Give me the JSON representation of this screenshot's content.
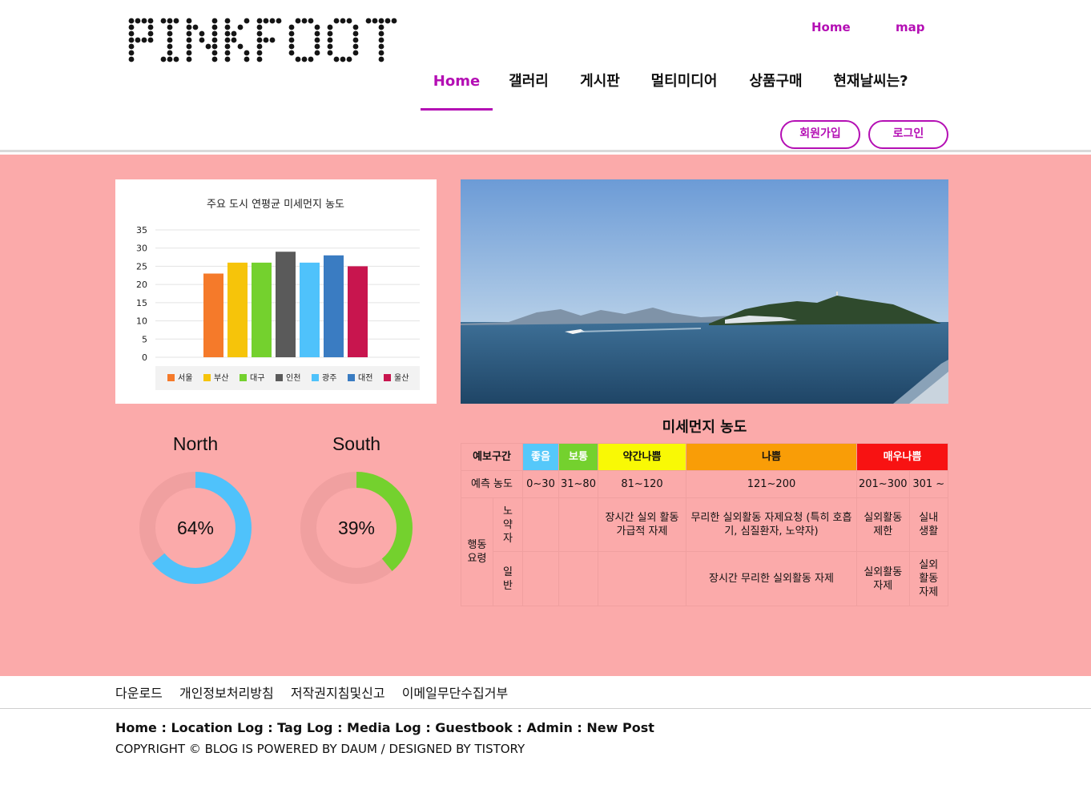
{
  "brand": {
    "logo_text": "PINKFOOT"
  },
  "topnav": {
    "home": "Home",
    "map": "map"
  },
  "mainnav": [
    {
      "label": "Home",
      "active": true
    },
    {
      "label": "갤러리"
    },
    {
      "label": "게시판"
    },
    {
      "label": "멀티미디어"
    },
    {
      "label": "상품구매"
    },
    {
      "label": "현재날씨는?"
    }
  ],
  "auth": {
    "signup": "회원가입",
    "login": "로그인"
  },
  "colors": {
    "accent": "#b40fb4",
    "main_bg": "#fbaaaa"
  },
  "chart_data": {
    "type": "bar",
    "title": "주요 도시 연평균 미세먼지 농도",
    "categories": [
      "서울",
      "부산",
      "대구",
      "인천",
      "광주",
      "대전",
      "울산"
    ],
    "values": [
      23,
      26,
      26,
      29,
      26,
      28,
      25
    ],
    "colors": [
      "#f57a2a",
      "#f6c40a",
      "#74d12e",
      "#5a5a5a",
      "#4fc2fb",
      "#3a7cc2",
      "#c8154e"
    ],
    "ylim": [
      0,
      35
    ],
    "yticks": [
      "35",
      "30",
      "25",
      "20",
      "15",
      "10",
      "5",
      "0"
    ],
    "grid": true,
    "legend": "bottom"
  },
  "donuts": [
    {
      "label": "North",
      "percent_text": "64%",
      "value": 0.64,
      "color": "#4fc2fb"
    },
    {
      "label": "South",
      "percent_text": "39%",
      "value": 0.39,
      "color": "#74d12e"
    }
  ],
  "dust_table": {
    "title": "미세먼지 농도",
    "header_label": "예보구간",
    "grades": [
      {
        "label": "좋음",
        "color": "#55c8fa",
        "text_color": "#ffffff"
      },
      {
        "label": "보통",
        "color": "#74d12e",
        "text_color": "#ffffff"
      },
      {
        "label": "약간나쁨",
        "color": "#f9f905",
        "text_color": "#111111"
      },
      {
        "label": "나쁨",
        "color": "#f99d07",
        "text_color": "#111111"
      },
      {
        "label": "매우나쁨",
        "color": "#f81212",
        "text_color": "#ffffff"
      }
    ],
    "conc_label": "예측 농도",
    "conc": [
      "0~30",
      "31~80",
      "81~120",
      "121~200",
      "201~300",
      "301 ~"
    ],
    "action_label": "행동 요령",
    "sensitive_label": "노약자",
    "general_label": "일반",
    "sensitive": [
      "",
      "",
      "장시간 실외 활동 가급적 자제",
      "무리한 실외활동 자제요청 (특히 호흡기, 심질환자, 노약자)",
      "실외활동 제한",
      "실내생활"
    ],
    "general": [
      "",
      "",
      "",
      "장시간 무리한 실외활동 자제",
      "실외활동 자제",
      "실외활동 자제"
    ]
  },
  "footer": {
    "links": [
      "다운로드",
      "개인정보처리방침",
      "저작권지침및신고",
      "이메일무단수집거부"
    ],
    "nav": "Home : Location Log : Tag Log : Media Log : Guestbook : Admin : New Post",
    "copyright": "COPYRIGHT © BLOG IS POWERED BY DAUM / DESIGNED BY TISTORY"
  }
}
